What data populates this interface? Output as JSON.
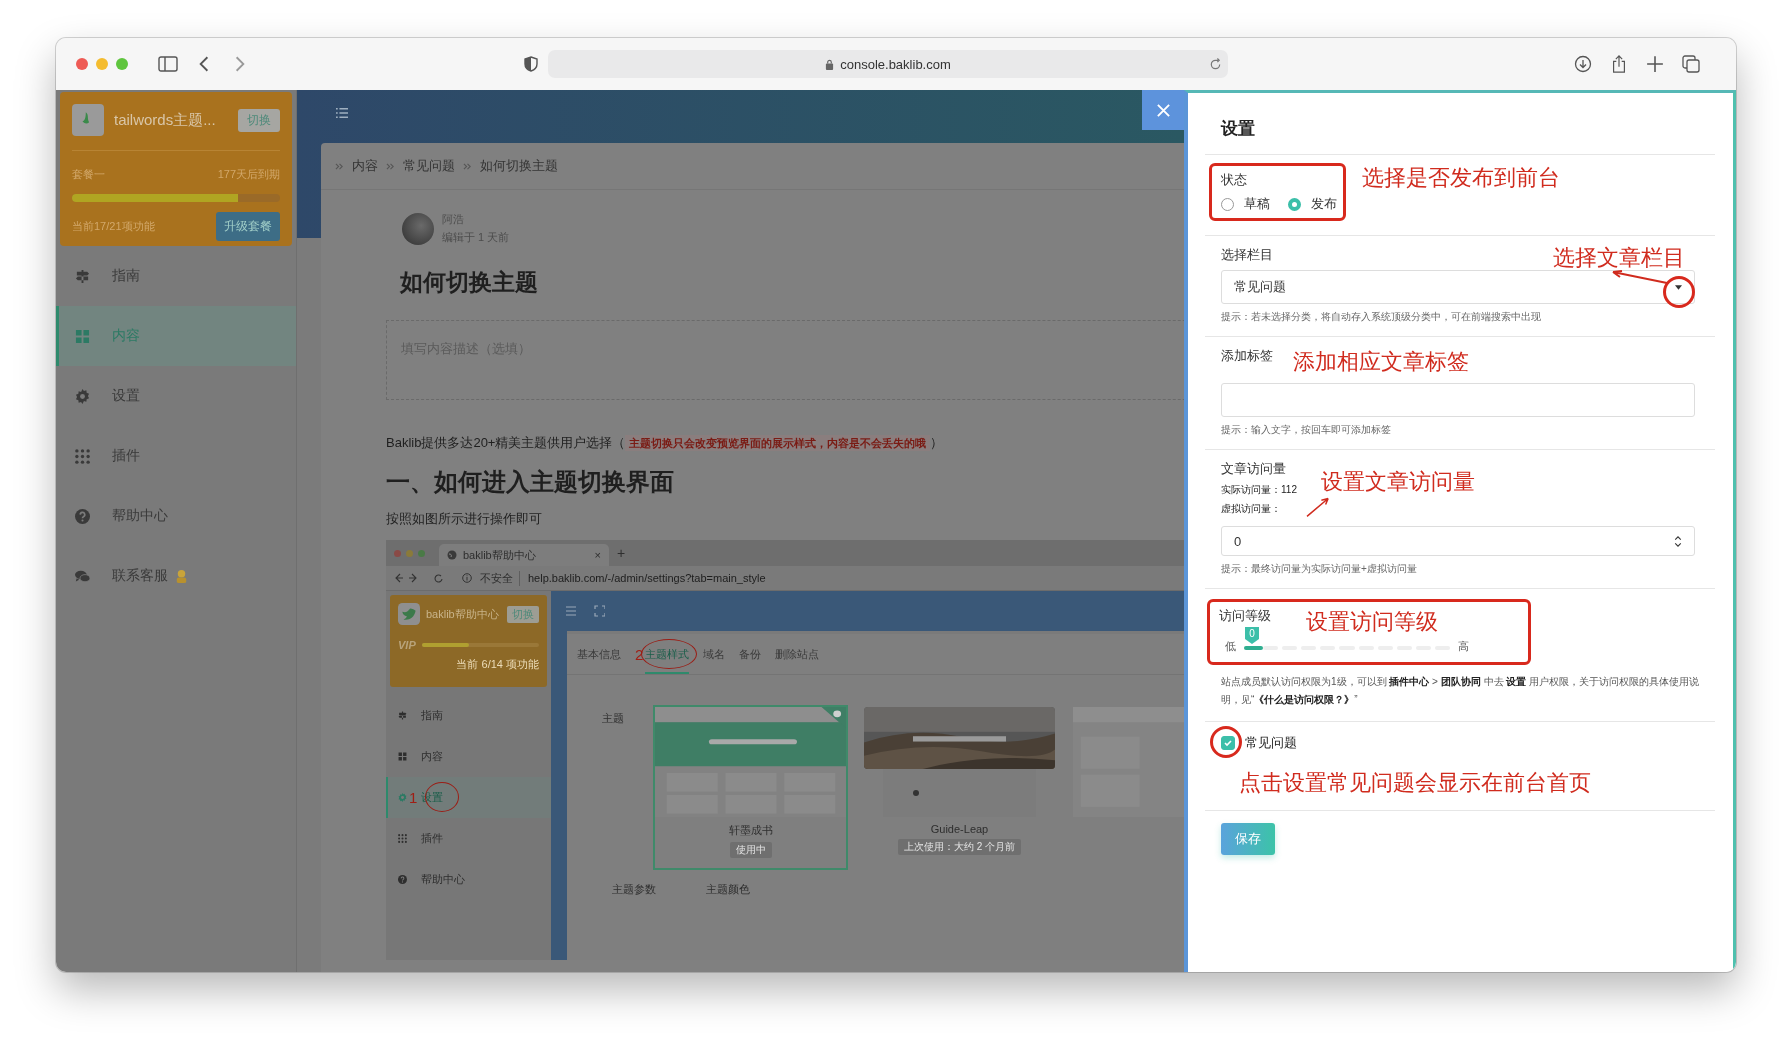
{
  "browser": {
    "url": "console.baklib.com"
  },
  "sidebar": {
    "workspace": {
      "name": "tailwords主题...",
      "switch_label": "切换",
      "plan": "套餐一",
      "expiry": "177天后到期",
      "level": 0.8,
      "features": "当前17/21项功能",
      "upgrade_label": "升级套餐"
    },
    "items": [
      {
        "kind": "guide",
        "label": "指南",
        "selected": false,
        "mascot": false
      },
      {
        "kind": "content",
        "label": "内容",
        "selected": true,
        "mascot": false
      },
      {
        "kind": "settings",
        "label": "设置",
        "selected": false,
        "mascot": false
      },
      {
        "kind": "plugins",
        "label": "插件",
        "selected": false,
        "mascot": false
      },
      {
        "kind": "help",
        "label": "帮助中心",
        "selected": false,
        "mascot": false
      },
      {
        "kind": "contact",
        "label": "联系客服",
        "selected": false,
        "mascot": true
      }
    ]
  },
  "article": {
    "breadcrumb": [
      "内容",
      "常见问题",
      "如何切换主题"
    ],
    "author": "阿浩",
    "edited": "编辑于 1 天前",
    "title": "如何切换主题",
    "description_placeholder": "填写内容描述（选填）",
    "intro": "Baklib提供多达20+精美主题供用户选择（",
    "intro_note": "主题切换只会改变预览界面的展示样式，内容是不会丢失的哦",
    "intro_end": "）",
    "heading": "一、如何进入主题切换界面",
    "instruction": "按照如图所示进行操作即可",
    "screenshot": {
      "tab_title": "baklib帮助中心",
      "tab_close": "×",
      "new_tab": "+",
      "security": "不安全",
      "url": "help.baklib.com/-/admin/settings?tab=main_style",
      "site": {
        "name": "baklib帮助中心",
        "switch_label": "切换",
        "badge": "VIP",
        "level": 0.4,
        "features": "当前 6/14 项功能"
      },
      "nav": [
        {
          "kind": "guide",
          "label": "指南",
          "selected": false
        },
        {
          "kind": "content",
          "label": "内容",
          "selected": false
        },
        {
          "kind": "settings",
          "label": "设置",
          "selected": true
        },
        {
          "kind": "plugins",
          "label": "插件",
          "selected": false
        },
        {
          "kind": "help",
          "label": "帮助中心",
          "selected": false
        }
      ],
      "step_1": "1",
      "step_2": "2",
      "tabs": [
        {
          "label": "基本信息",
          "selected": false
        },
        {
          "label": "主题样式",
          "selected": true
        },
        {
          "label": "域名",
          "selected": false
        },
        {
          "label": "备份",
          "selected": false
        },
        {
          "label": "删除站点",
          "selected": false
        }
      ],
      "theme_label": "主题",
      "themes": [
        {
          "kind": "green",
          "name": "轩墨成书",
          "status": "使用中",
          "selected": true
        },
        {
          "kind": "desert",
          "name": "Guide-Leap",
          "status": "上次使用：大约 2 个月前",
          "selected": false
        },
        {
          "kind": "light",
          "selected": false
        }
      ],
      "footer_labels": [
        "主题参数",
        "主题颜色"
      ]
    }
  },
  "drawer": {
    "title": "设置",
    "status": {
      "label": "状态",
      "options": [
        {
          "label": "草稿",
          "selected": false
        },
        {
          "label": "发布",
          "selected": true
        }
      ],
      "annotation": "选择是否发布到前台"
    },
    "category": {
      "label": "选择栏目",
      "value": "常见问题",
      "hint": "提示：若未选择分类，将自动存入系统顶级分类中，可在前端搜索中出现",
      "annotation": "选择文章栏目"
    },
    "tags": {
      "label": "添加标签",
      "hint": "提示：输入文字，按回车即可添加标签",
      "annotation": "添加相应文章标签"
    },
    "visits": {
      "label": "文章访问量",
      "actual": "实际访问量：112",
      "virtual_label": "虚拟访问量：",
      "value": "0",
      "hint": "提示：最终访问量为实际访问量+虚拟访问量",
      "annotation": "设置文章访问量"
    },
    "access": {
      "label": "访问等级",
      "low": "低",
      "high": "高",
      "tooltip": "0",
      "annotation": "设置访问等级",
      "hint": "站点成员默认访问权限为1级，可以到 **插件中心** > **团队协同** 中去 **设置** 用户权限，关于访问权限的具体使用说明，见“**《什么是访问权限？》**”"
    },
    "faq": {
      "label": "常见问题",
      "checked": true,
      "annotation": "点击设置常见问题会显示在前台首页"
    },
    "save": "保存"
  }
}
